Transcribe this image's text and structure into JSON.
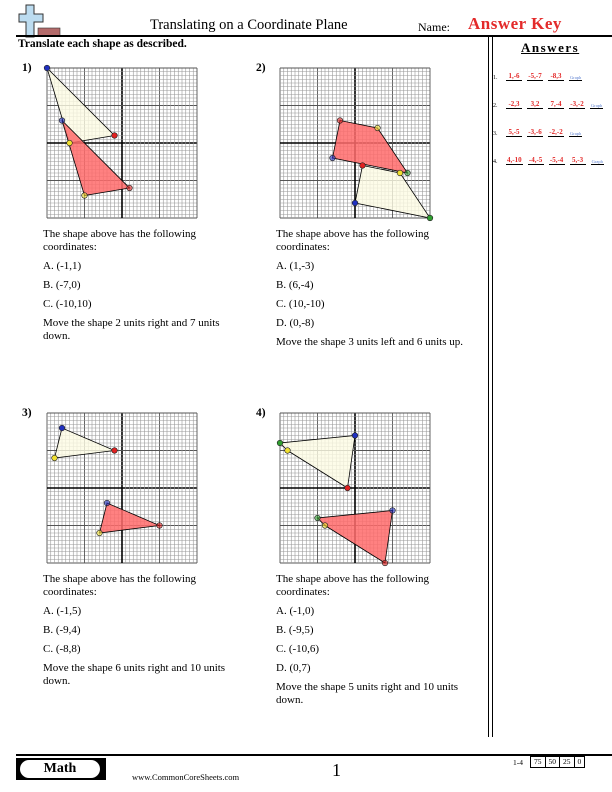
{
  "header": {
    "title": "Translating on a Coordinate Plane",
    "name_label": "Name:",
    "answer_key": "Answer Key",
    "instructions": "Translate each shape as described."
  },
  "answers_panel": {
    "title": "Answers",
    "rows": [
      {
        "num": "1.",
        "values": [
          "1,-6",
          "-5,-7",
          "-8,3"
        ],
        "graph": "Graph"
      },
      {
        "num": "2.",
        "values": [
          "-2,3",
          "3,2",
          "7,-4",
          "-3,-2"
        ],
        "graph": "Graph"
      },
      {
        "num": "3.",
        "values": [
          "5,-5",
          "-3,-6",
          "-2,-2"
        ],
        "graph": "Graph"
      },
      {
        "num": "4.",
        "values": [
          "4,-10",
          "-4,-5",
          "-5,-4",
          "5,-3"
        ],
        "graph": "Graph"
      }
    ]
  },
  "colors": {
    "red_fill": "#ff6b6b",
    "yellow_fill": "#fdfbe3",
    "answer_red": "#e32a2a",
    "graph_blue": "#5b7fd0",
    "vertex_colors": [
      "#e02020",
      "#f0e030",
      "#2030c0",
      "#30a030"
    ]
  },
  "problems": [
    {
      "number": "1)",
      "intro": "The shape above has the following coordinates:",
      "points": [
        {
          "label": "A",
          "coord": "(-1,1)"
        },
        {
          "label": "B",
          "coord": "(-7,0)"
        },
        {
          "label": "C",
          "coord": "(-10,10)"
        }
      ],
      "instruction": "Move the shape 2 units right and 7 units down.",
      "original": [
        [
          -1,
          1
        ],
        [
          -7,
          0
        ],
        [
          -10,
          10
        ]
      ],
      "translated": [
        [
          1,
          -6
        ],
        [
          -5,
          -7
        ],
        [
          -8,
          3
        ]
      ],
      "vertex_colors": [
        "#e02020",
        "#f0e030",
        "#2030c0"
      ]
    },
    {
      "number": "2)",
      "intro": "The shape above has the following coordinates:",
      "points": [
        {
          "label": "A",
          "coord": "(1,-3)"
        },
        {
          "label": "B",
          "coord": "(6,-4)"
        },
        {
          "label": "C",
          "coord": "(10,-10)"
        },
        {
          "label": "D",
          "coord": "(0,-8)"
        }
      ],
      "instruction": "Move the shape 3 units left and 6 units up.",
      "original": [
        [
          1,
          -3
        ],
        [
          6,
          -4
        ],
        [
          10,
          -10
        ],
        [
          0,
          -8
        ]
      ],
      "translated": [
        [
          -2,
          3
        ],
        [
          3,
          2
        ],
        [
          7,
          -4
        ],
        [
          -3,
          -2
        ]
      ],
      "vertex_colors": [
        "#e02020",
        "#f0e030",
        "#30a030",
        "#2030c0"
      ]
    },
    {
      "number": "3)",
      "intro": "The shape above has the following coordinates:",
      "points": [
        {
          "label": "A",
          "coord": "(-1,5)"
        },
        {
          "label": "B",
          "coord": "(-9,4)"
        },
        {
          "label": "C",
          "coord": "(-8,8)"
        }
      ],
      "instruction": "Move the shape 6 units right and 10 units down.",
      "original": [
        [
          -1,
          5
        ],
        [
          -9,
          4
        ],
        [
          -8,
          8
        ]
      ],
      "translated": [
        [
          5,
          -5
        ],
        [
          -3,
          -6
        ],
        [
          -2,
          -2
        ]
      ],
      "vertex_colors": [
        "#e02020",
        "#f0e030",
        "#2030c0"
      ]
    },
    {
      "number": "4)",
      "intro": "The shape above has the following coordinates:",
      "points": [
        {
          "label": "A",
          "coord": "(-1,0)"
        },
        {
          "label": "B",
          "coord": "(-9,5)"
        },
        {
          "label": "C",
          "coord": "(-10,6)"
        },
        {
          "label": "D",
          "coord": "(0,7)"
        }
      ],
      "instruction": "Move the shape 5 units right and 10 units down.",
      "original": [
        [
          -1,
          0
        ],
        [
          -9,
          5
        ],
        [
          -10,
          6
        ],
        [
          0,
          7
        ]
      ],
      "translated": [
        [
          4,
          -10
        ],
        [
          -4,
          -5
        ],
        [
          -5,
          -4
        ],
        [
          5,
          -3
        ]
      ],
      "vertex_colors": [
        "#e02020",
        "#f0e030",
        "#30a030",
        "#2030c0"
      ]
    }
  ],
  "grid": {
    "xmin": -10,
    "xmax": 10,
    "ymin": -10,
    "ymax": 10
  },
  "footer": {
    "subject": "Math",
    "site": "www.CommonCoreSheets.com",
    "page": "1",
    "score_range": "1-4",
    "scores": [
      "75",
      "50",
      "25",
      "0"
    ]
  }
}
